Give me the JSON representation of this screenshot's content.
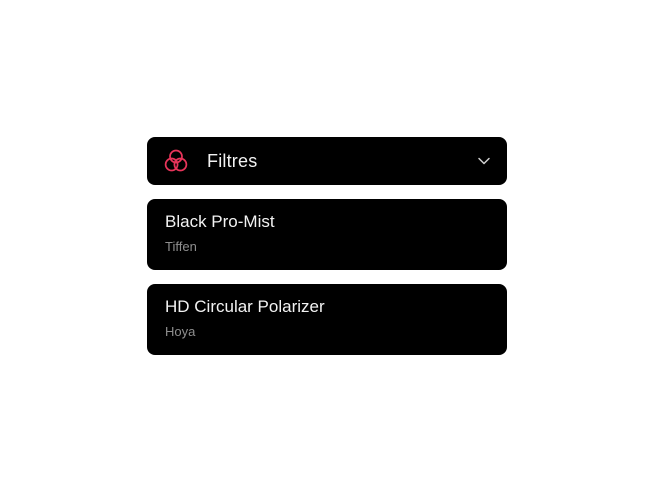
{
  "filters_dropdown": {
    "title": "Filtres",
    "icon": "filter-rings-icon",
    "accent_color": "#e8345a",
    "chevron_icon": "chevron-down-icon"
  },
  "filters": [
    {
      "name": "Black Pro-Mist",
      "brand": "Tiffen"
    },
    {
      "name": "HD Circular Polarizer",
      "brand": "Hoya"
    }
  ]
}
